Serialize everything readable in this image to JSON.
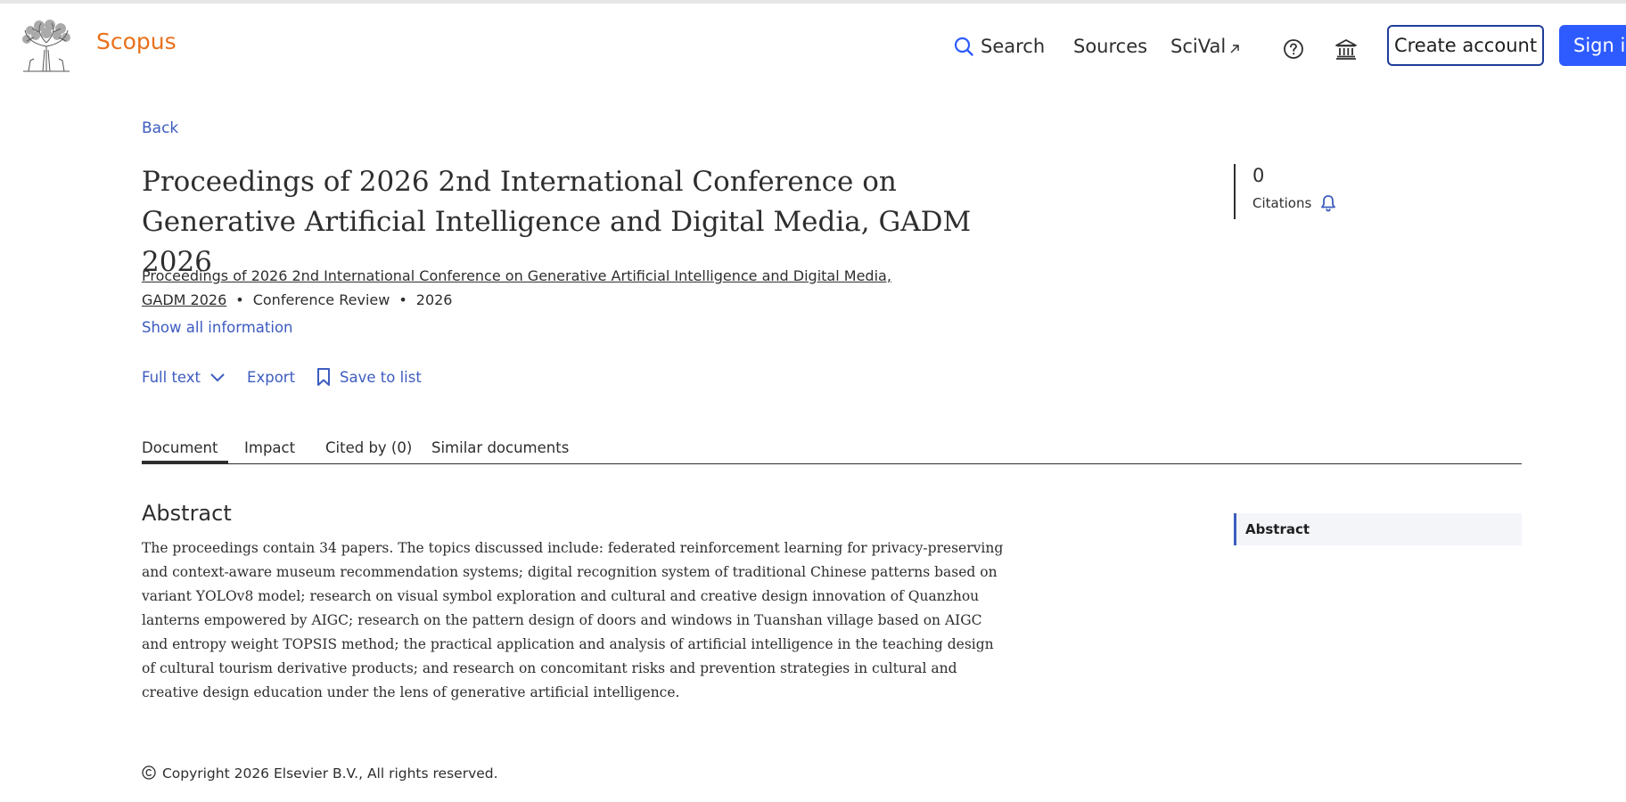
{
  "header": {
    "brand": "Scopus",
    "nav": {
      "search": "Search",
      "sources": "Sources",
      "scival": "SciVal"
    },
    "create_account": "Create account",
    "sign_in": "Sign in"
  },
  "back": "Back",
  "document": {
    "title": "Proceedings of 2026 2nd International Conference on Generative Artificial Intelligence and Digital Media, GADM 2026",
    "source_title": "Proceedings of 2026 2nd International Conference on Generative Artificial Intelligence and Digital Media, GADM 2026",
    "type": "Conference Review",
    "year": "2026",
    "show_all": "Show all information"
  },
  "actions": {
    "full_text": "Full text",
    "export": "Export",
    "save": "Save to list"
  },
  "citations": {
    "count": "0",
    "label": "Citations"
  },
  "tabs": {
    "document": "Document",
    "impact": "Impact",
    "cited_by": "Cited by (0)",
    "similar": "Similar documents"
  },
  "abstract": {
    "heading": "Abstract",
    "text": "The proceedings contain 34 papers. The topics discussed include: federated reinforcement learning for privacy-preserving and context-aware museum recommendation systems; digital recognition system of traditional Chinese patterns based on variant YOLOv8 model; research on visual symbol exploration and cultural and creative design innovation of Quanzhou lanterns empowered by AIGC; research on the pattern design of doors and windows in Tuanshan village based on AIGC and entropy weight TOPSIS method; the practical application and analysis of artificial intelligence in the teaching design of cultural tourism derivative products; and research on concomitant risks and prevention strategies in cultural and creative design education under the lens of generative artificial intelligence."
  },
  "side_nav": {
    "abstract": "Abstract"
  },
  "footer": {
    "copyright": "Copyright 2026 Elsevier B.V., All rights reserved."
  },
  "colors": {
    "brand": "#e9711c",
    "link": "#3d5cbf",
    "primary_button": "#2e5bff",
    "text": "#2e2e2e"
  },
  "icons": {
    "logo": "elsevier-tree-logo",
    "search": "search-icon",
    "external": "external-link-icon",
    "help": "help-icon",
    "institution": "institution-icon",
    "chevron": "chevron-down-icon",
    "bookmark": "bookmark-icon",
    "bell": "bell-icon",
    "copyright": "copyright-icon"
  }
}
